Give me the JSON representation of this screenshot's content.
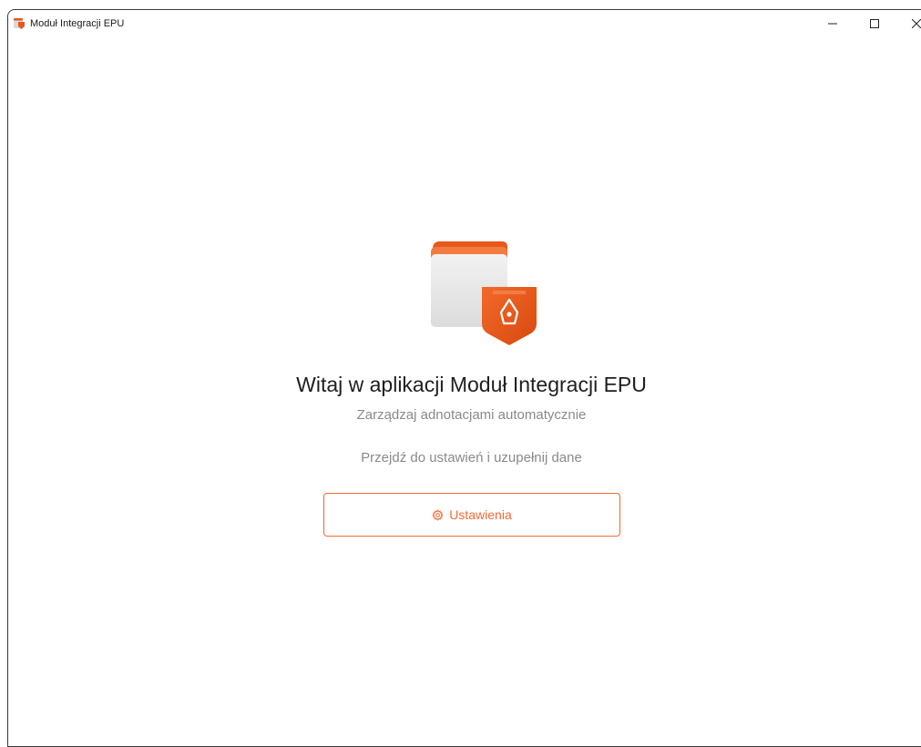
{
  "window": {
    "title": "Moduł Integracji EPU",
    "app_icon": "shield-folder-logo-icon",
    "controls": {
      "minimize_icon": "minimize-icon",
      "maximize_icon": "maximize-icon",
      "close_icon": "close-icon"
    }
  },
  "welcome": {
    "illustration_icon": "folder-shield-pen-icon",
    "heading": "Witaj w aplikacji Moduł Integracji EPU",
    "subtitle": "Zarządzaj adnotacjami automatycznie",
    "hint": "Przejdź do ustawień i uzupełnij dane",
    "settings_button": {
      "label": "Ustawienia",
      "icon": "gear-icon"
    }
  },
  "colors": {
    "accent": "#f06a35",
    "shield": "#e8581d",
    "folder_tab": "#e8581d",
    "folder_body": "#e6e6e6",
    "muted_text": "#8a8a8a"
  }
}
